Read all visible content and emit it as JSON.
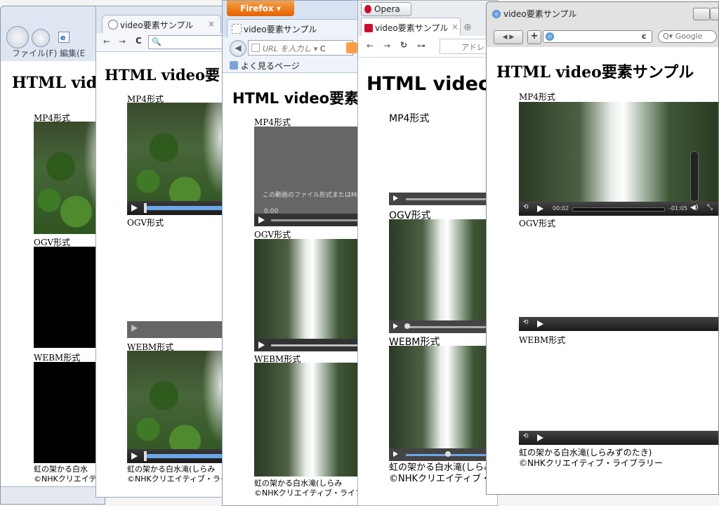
{
  "page": {
    "title": "HTML video要素サンプル",
    "title_short": "HTML vid",
    "title_firefox": "HTML video要素",
    "title_opera": "HTML video",
    "title_chrome": "HTML video要",
    "mp4_label": "MP4形式",
    "ogv_label": "OGV形式",
    "webm_label": "WEBM形式",
    "caption_line1": "虹の架かる白水滝(しらみずのたき)",
    "caption_line2": "©NHKクリエイティブ・ライブラリー",
    "caption_short1": "虹の架かる白水滝(しらみ",
    "caption_short2": "©NHKクリエイティブ・ライブ",
    "caption_ie1": "虹の架かる白水",
    "caption_ie2": "©NHKクリエイテ"
  },
  "ie": {
    "menu": "ファイル(F)   編集(E"
  },
  "chrome": {
    "tab_label": "video要素サンプル",
    "tab_close": "×",
    "url_placeholder": "🔍"
  },
  "firefox": {
    "app_button": "Firefox",
    "tab_label": "video要素サンプル",
    "url_placeholder": "URL を入力し",
    "bookmarks": "よく見るページ",
    "video_error": "この動画のファイル形式またはMIME",
    "time": "0:00"
  },
  "opera": {
    "app_button": "Opera",
    "tab_label": "video要素サンプル",
    "tab_close": "×",
    "url_placeholder": "アドレ"
  },
  "safari": {
    "title": "video要素サンプル",
    "search_placeholder": "Q▾ Google",
    "time_elapsed": "00:02",
    "time_remaining": "-01:05"
  },
  "colors": {
    "firefox_orange": "#e66000",
    "chrome_blue": "#6aa7e8"
  }
}
